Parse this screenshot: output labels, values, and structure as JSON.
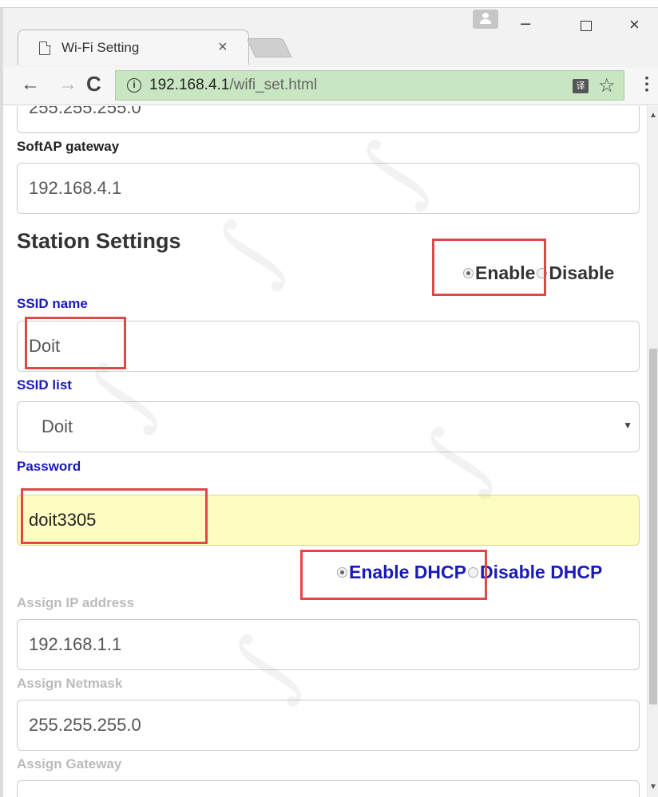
{
  "browser": {
    "tab_title": "Wi-Fi Setting",
    "tab_close": "×",
    "window_min": "–",
    "window_close": "×",
    "back": "←",
    "forward": "→",
    "reload": "C",
    "info": "i",
    "url_host": "192.168.4.1",
    "url_path": "/wifi_set.html",
    "translate": "译",
    "star": "☆",
    "menu": "⋮"
  },
  "softap": {
    "netmask_partial": "255.255.255.0",
    "gateway_label": "SoftAP gateway",
    "gateway_value": "192.168.4.1"
  },
  "station": {
    "title": "Station Settings",
    "mode": {
      "enable": "Enable",
      "disable": "Disable",
      "selected": "Enable"
    },
    "ssid_name_label": "SSID name",
    "ssid_name_value": "Doit",
    "ssid_list_label": "SSID list",
    "ssid_list_value": "Doit",
    "password_label": "Password",
    "password_value": "doit3305",
    "dhcp": {
      "enable": "Enable DHCP",
      "disable": "Disable DHCP",
      "selected": "Enable DHCP"
    },
    "assign_ip_label": "Assign IP address",
    "assign_ip_value": "192.168.1.1",
    "assign_netmask_label": "Assign Netmask",
    "assign_netmask_value": "255.255.255.0",
    "assign_gateway_label": "Assign Gateway"
  },
  "colors": {
    "label_blue": "#1a1ab8",
    "highlight_red": "#e04848",
    "password_bg": "#fcfcc0",
    "omnibox_green": "#c8e6c2"
  }
}
